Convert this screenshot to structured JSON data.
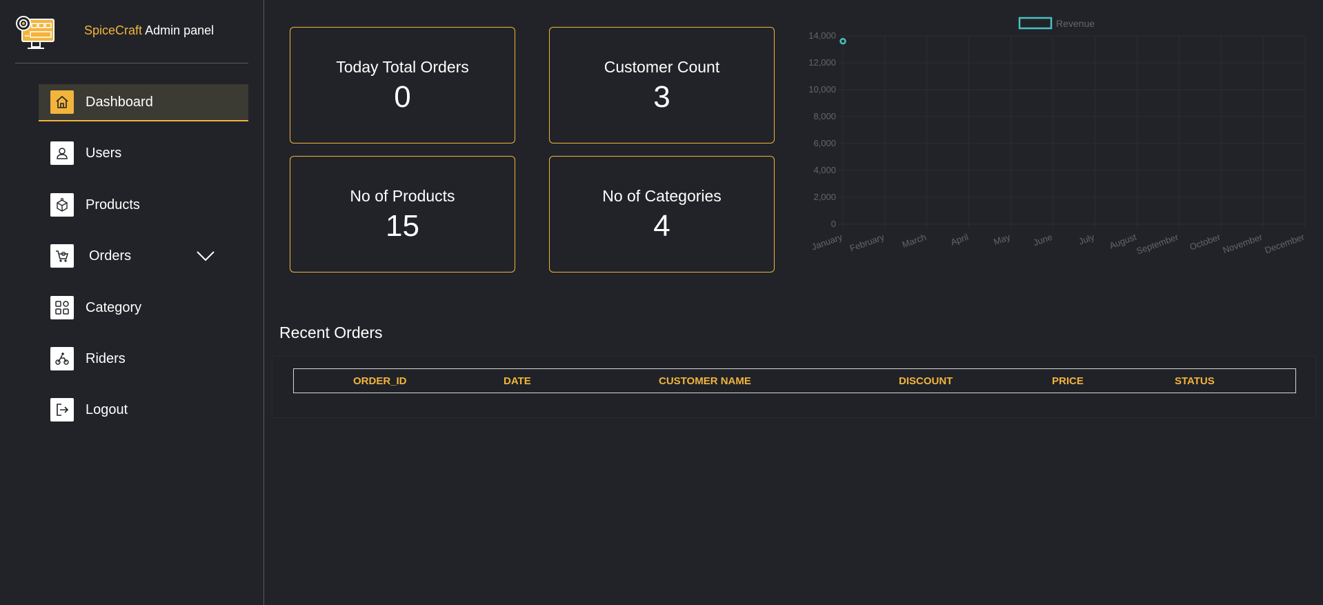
{
  "brand": {
    "accent": "SpiceCraft",
    "rest": "Admin panel",
    "logo_icon": "monitor-gear-logo"
  },
  "sidebar": {
    "items": [
      {
        "label": "Dashboard",
        "icon": "home-icon",
        "active": true
      },
      {
        "label": "Users",
        "icon": "user-icon",
        "active": false
      },
      {
        "label": "Products",
        "icon": "box-icon",
        "active": false
      },
      {
        "label": "Orders",
        "icon": "cart-icon",
        "active": false,
        "has_dropdown": true
      },
      {
        "label": "Category",
        "icon": "grid-icon",
        "active": false
      },
      {
        "label": "Riders",
        "icon": "rider-icon",
        "active": false
      },
      {
        "label": "Logout",
        "icon": "logout-icon",
        "active": false
      }
    ]
  },
  "cards": [
    {
      "title": "Today Total Orders",
      "value": "0"
    },
    {
      "title": "Customer Count",
      "value": "3"
    },
    {
      "title": "No of Products",
      "value": "15"
    },
    {
      "title": "No of Categories",
      "value": "4"
    }
  ],
  "chart_data": {
    "type": "line",
    "categories": [
      "January",
      "February",
      "March",
      "April",
      "May",
      "June",
      "July",
      "August",
      "September",
      "October",
      "November",
      "December"
    ],
    "series": [
      {
        "name": "Revenue",
        "values": [
          13600,
          null,
          null,
          null,
          null,
          null,
          null,
          null,
          null,
          null,
          null,
          null
        ]
      }
    ],
    "title": "",
    "xlabel": "",
    "ylabel": "",
    "ylim": [
      0,
      14000
    ],
    "yticks": [
      "0",
      "2,000",
      "4,000",
      "6,000",
      "8,000",
      "10,000",
      "12,000",
      "14,000"
    ],
    "grid": true,
    "legend": "top-center",
    "colors": {
      "series": "#4bc0c0",
      "axis_text": "#666666",
      "grid": "#2c2e33"
    }
  },
  "recent_orders": {
    "title": "Recent Orders",
    "columns": [
      "ORDER_ID",
      "DATE",
      "CUSTOMER NAME",
      "DISCOUNT",
      "PRICE",
      "STATUS"
    ],
    "rows": []
  },
  "colors": {
    "accent": "#f3b43c",
    "background": "#212328",
    "text": "#ffffff"
  }
}
